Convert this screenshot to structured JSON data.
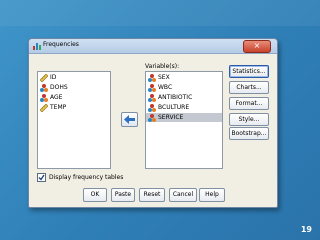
{
  "slide": {
    "number": "19"
  },
  "dialog": {
    "title": "Frequencies",
    "close_label": "×",
    "source_variables": [
      {
        "label": "ID",
        "icon": "ruler-icon"
      },
      {
        "label": "DOHS",
        "icon": "nominal-icon"
      },
      {
        "label": "AGE",
        "icon": "nominal-icon"
      },
      {
        "label": "TEMP",
        "icon": "ruler-icon"
      }
    ],
    "variables_label": "Variable(s):",
    "selected_variables": [
      {
        "label": "SEX",
        "icon": "nominal-icon",
        "selected": false
      },
      {
        "label": "WBC",
        "icon": "nominal-icon",
        "selected": false
      },
      {
        "label": "ANTIBIOTIC",
        "icon": "nominal-icon",
        "selected": false
      },
      {
        "label": "BCULTURE",
        "icon": "nominal-icon",
        "selected": false
      },
      {
        "label": "SERVICE",
        "icon": "nominal-icon",
        "selected": true
      }
    ],
    "side_buttons": {
      "statistics": "Statistics...",
      "charts": "Charts...",
      "format": "Format...",
      "style": "Style...",
      "bootstrap": "Bootstrap..."
    },
    "display_tables_label": "Display frequency tables",
    "display_tables_checked": true,
    "bottom_buttons": {
      "ok": "OK",
      "paste": "Paste",
      "reset": "Reset",
      "cancel": "Cancel",
      "help": "Help"
    },
    "colors": {
      "slide_background": "#2f7fb7",
      "dialog_background": "#f1efe3",
      "close_button": "#c7432b",
      "selection": "#c4c9d1",
      "move_arrow": "#2f6fc2"
    }
  }
}
